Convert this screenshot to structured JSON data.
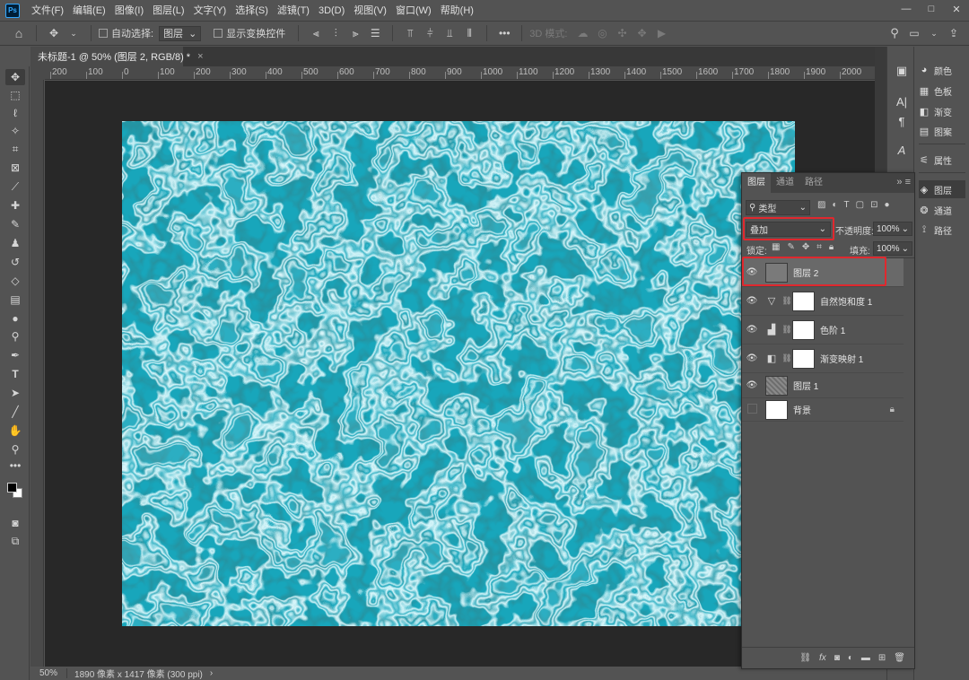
{
  "app": {
    "logo": "Ps"
  },
  "menu": [
    "文件(F)",
    "编辑(E)",
    "图像(I)",
    "图层(L)",
    "文字(Y)",
    "选择(S)",
    "滤镜(T)",
    "3D(D)",
    "视图(V)",
    "窗口(W)",
    "帮助(H)"
  ],
  "window_controls": [
    "—",
    "□",
    "✕"
  ],
  "options_bar": {
    "auto_select_label": "自动选择:",
    "auto_select_value": "图层",
    "show_transform_label": "显示变换控件",
    "mode_3d_label": "3D 模式:",
    "more": "•••"
  },
  "document": {
    "tab_title": "未标题-1 @ 50% (图层 2, RGB/8) *",
    "close": "×"
  },
  "ruler": {
    "ticks": [
      "200",
      "100",
      "0",
      "100",
      "200",
      "300",
      "400",
      "500",
      "600",
      "700",
      "800",
      "900",
      "1000",
      "1100",
      "1200",
      "1300",
      "1400",
      "1500",
      "1600",
      "1700",
      "1800",
      "1900",
      "2000",
      "2100"
    ]
  },
  "status": {
    "zoom": "50%",
    "info": "1890 像素 x 1417 像素 (300 ppi)",
    "arrow": "›"
  },
  "right_panels": {
    "group1": [
      {
        "label": "颜色",
        "icon": "◕"
      },
      {
        "label": "色板",
        "icon": "▦"
      },
      {
        "label": "渐变",
        "icon": "◧"
      },
      {
        "label": "图案",
        "icon": "▤"
      }
    ],
    "group2": [
      {
        "label": "属性",
        "icon": "⚟"
      }
    ],
    "group3": [
      {
        "label": "图层",
        "icon": "◈"
      },
      {
        "label": "通道",
        "icon": "❂"
      },
      {
        "label": "路径",
        "icon": "⟟"
      }
    ]
  },
  "layers_panel": {
    "tabs": [
      "图层",
      "通道",
      "路径"
    ],
    "menu": "»  ≡",
    "filter_label": "类型",
    "blend_mode": "叠加",
    "opacity_label": "不透明度:",
    "opacity_value": "100%",
    "lock_label": "锁定:",
    "fill_label": "填充:",
    "fill_value": "100%",
    "layers": [
      {
        "name": "图层 2",
        "selected": true,
        "type": "pixel"
      },
      {
        "name": "自然饱和度 1",
        "type": "adjustment",
        "icon": "▽"
      },
      {
        "name": "色阶 1",
        "type": "adjustment",
        "icon": "▟"
      },
      {
        "name": "渐变映射 1",
        "type": "adjustment",
        "icon": "◧"
      },
      {
        "name": "图层 1",
        "type": "noise"
      },
      {
        "name": "背景",
        "type": "background",
        "visible": false,
        "locked": true
      }
    ]
  },
  "colors": {
    "accent_highlight": "#e0282e",
    "canvas_water": "#1aa3b8"
  }
}
